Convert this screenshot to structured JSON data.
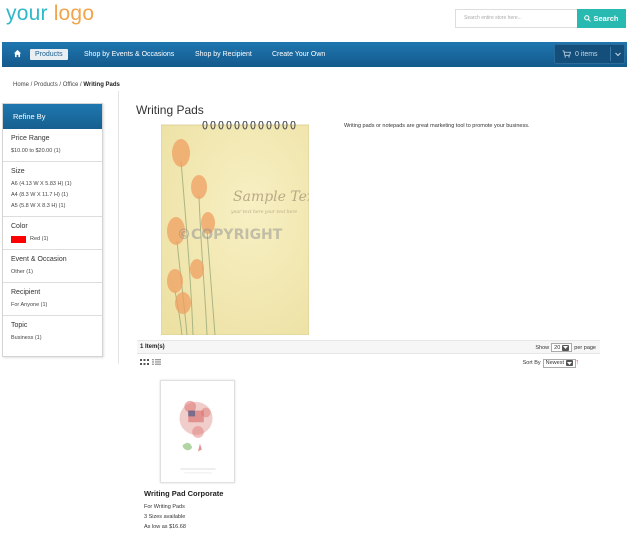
{
  "logo": {
    "part1": "your",
    "part2": " logo"
  },
  "search": {
    "placeholder": "Search entire store here...",
    "button_label": "Search"
  },
  "nav": {
    "items": [
      {
        "label": "Products"
      },
      {
        "label": "Shop by Events & Occasions"
      },
      {
        "label": "Shop by Recipient"
      },
      {
        "label": "Create Your Own"
      }
    ],
    "cart_label": "0 items"
  },
  "breadcrumb": [
    "Home",
    "Products",
    "Office",
    "Writing Pads"
  ],
  "sidebar": {
    "title": "Refine By",
    "facets": [
      {
        "title": "Price Range",
        "options": [
          {
            "label": "$10.00 to $20.00 (1)"
          }
        ]
      },
      {
        "title": "Size",
        "options": [
          {
            "label": "A6 (4.13 W X 5.83 H) (1)"
          },
          {
            "label": "A4 (8.3 W X 11.7 H) (1)"
          },
          {
            "label": "A5 (5.8 W X 8.3 H) (1)"
          }
        ]
      },
      {
        "title": "Color",
        "options": [
          {
            "label": "Red (1)",
            "swatch": "#ff0000"
          }
        ]
      },
      {
        "title": "Event & Occasion",
        "options": [
          {
            "label": "Other (1)"
          }
        ]
      },
      {
        "title": "Recipient",
        "options": [
          {
            "label": "For Anyone (1)"
          }
        ]
      },
      {
        "title": "Topic",
        "options": [
          {
            "label": "Business (1)"
          }
        ]
      }
    ]
  },
  "main": {
    "title": "Writing Pads",
    "description": "Writing pads or notepads are great marketing tool to promote your business.",
    "image_text": {
      "sample": "Sample Text",
      "sub": "your text here your text here",
      "copyright": "©COPYRIGHT"
    },
    "toolbar": {
      "count": "1 Item(s)",
      "show_label": "Show",
      "show_value": "20",
      "per_page": "per page",
      "sort_label": "Sort By",
      "sort_value": "Newest",
      "sort_dir": "↑"
    },
    "product": {
      "name": "Writing Pad Corporate",
      "category": "For Writing Pads",
      "sizes": "3 Sizes available",
      "price": "As low as $16.68"
    }
  },
  "colors": {
    "brand_teal": "#2fb8c9",
    "brand_orange": "#f2a54a",
    "nav_blue": "#1f77b0",
    "search_button": "#28b9b1"
  }
}
